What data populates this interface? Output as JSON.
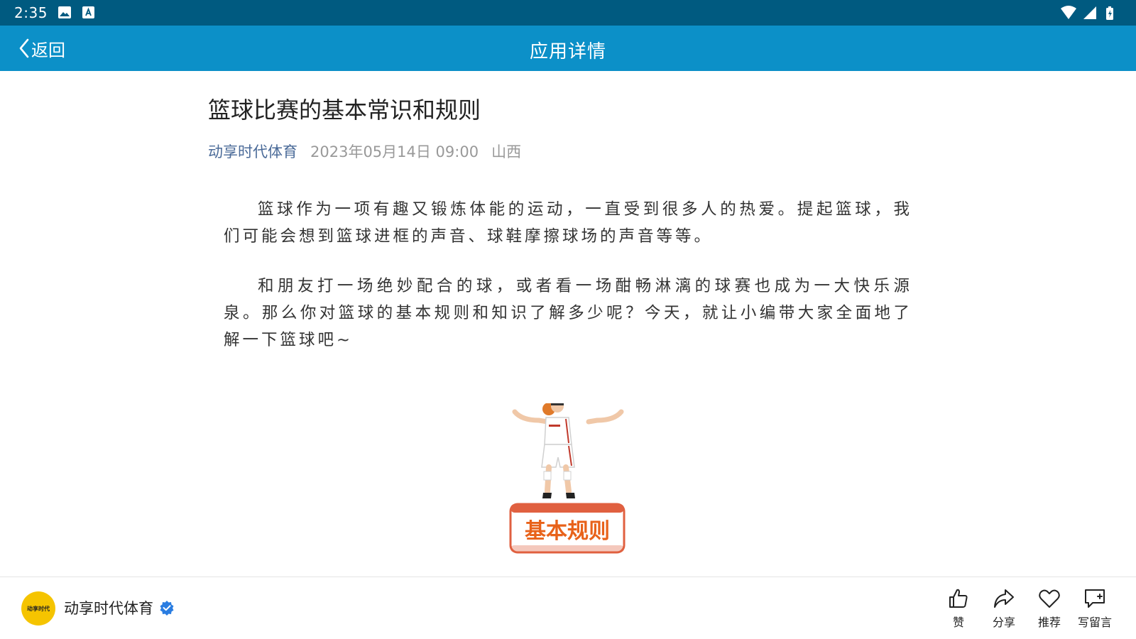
{
  "status_bar": {
    "time": "2:35",
    "icons": [
      "image-icon",
      "a-badge-icon",
      "wifi-icon",
      "signal-icon",
      "battery-icon"
    ]
  },
  "app_bar": {
    "back_label": "返回",
    "title": "应用详情",
    "background": "#0c90c8"
  },
  "article": {
    "title": "篮球比赛的基本常识和规则",
    "source": "动享时代体育",
    "date": "2023年05月14日 09:00",
    "location": "山西",
    "paragraphs": [
      "篮球作为一项有趣又锻炼体能的运动，一直受到很多人的热爱。提起篮球，我们可能会想到篮球进框的声音、球鞋摩擦球场的声音等等。",
      "和朋友打一场绝妙配合的球，或者看一场酣畅淋漓的球赛也成为一大快乐源泉。那么你对篮球的基本规则和知识了解多少呢？今天，就让小编带大家全面地了解一下篮球吧~"
    ],
    "illustration_label": "基本规则"
  },
  "footer": {
    "avatar_text": "动享时代",
    "author_name": "动享时代体育",
    "actions": {
      "like": "赞",
      "share": "分享",
      "recommend": "推荐",
      "comment": "写留言"
    }
  }
}
